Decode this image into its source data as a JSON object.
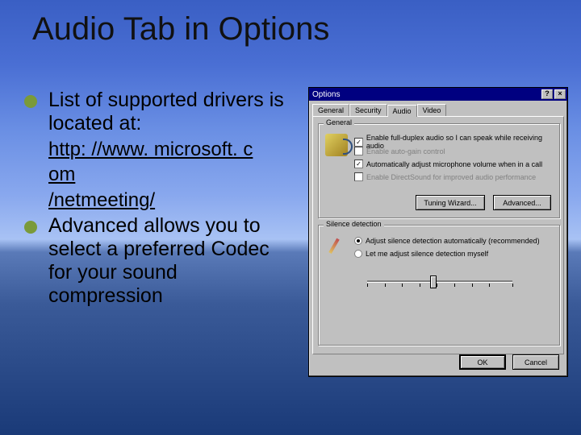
{
  "title": "Audio Tab in Options",
  "bullets": {
    "b1": "List of supported drivers is located at:",
    "link1": "http: //www. microsoft. c",
    "link2": "om",
    "link3": "/netmeeting/",
    "b2": "Advanced allows you to select a preferred Codec for your sound compression"
  },
  "dialog": {
    "title": "Options",
    "help": "?",
    "close": "×",
    "tabs": {
      "general": "General",
      "security": "Security",
      "audio": "Audio",
      "video": "Video"
    },
    "group_general": "General",
    "chk1": "Enable full-duplex audio so I can speak while receiving audio",
    "chk2": "Enable auto-gain control",
    "chk3": "Automatically adjust microphone volume when in a call",
    "chk4": "Enable DirectSound for improved audio performance",
    "btn_tuning": "Tuning Wizard...",
    "btn_advanced": "Advanced...",
    "group_silence": "Silence detection",
    "radio1": "Adjust silence detection automatically (recommended)",
    "radio2": "Let me adjust silence detection myself",
    "btn_ok": "OK",
    "btn_cancel": "Cancel"
  }
}
